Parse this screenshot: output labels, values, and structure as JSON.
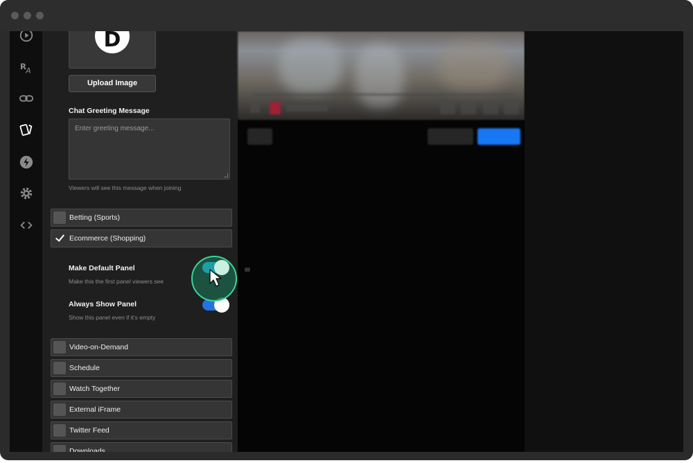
{
  "window": {
    "title_dots": [
      "close",
      "minimize",
      "maximize"
    ]
  },
  "nav": {
    "icons": [
      "play-circle-icon",
      "font-size-icon",
      "link-icon",
      "cards-icon",
      "bolt-icon",
      "gear-icon",
      "code-icon"
    ],
    "active": "cards-icon"
  },
  "panel": {
    "logo_letter": "D",
    "upload_label": "Upload Image",
    "greeting_label": "Chat Greeting Message",
    "greeting_placeholder": "Enter greeting message...",
    "greeting_hint": "Viewers will see this message when joining",
    "options": [
      {
        "label": "Betting (Sports)",
        "checked": false
      },
      {
        "label": "Ecommerce (Shopping)",
        "checked": true
      }
    ],
    "default_panel": {
      "label": "Make Default Panel",
      "hint": "Make this the first panel viewers see",
      "on": true
    },
    "always_show": {
      "label": "Always Show Panel",
      "hint": "Show this panel even if it's empty",
      "on": true
    },
    "more_options": [
      {
        "label": "Video-on-Demand",
        "checked": false
      },
      {
        "label": "Schedule",
        "checked": false
      },
      {
        "label": "Watch Together",
        "checked": false
      },
      {
        "label": "External iFrame",
        "checked": false
      },
      {
        "label": "Twitter Feed",
        "checked": false
      },
      {
        "label": "Downloads",
        "checked": false
      }
    ]
  },
  "colors": {
    "toggle_on": "#2374e1",
    "focus_ring": "#38d69a",
    "share_button": "#1877f2"
  }
}
